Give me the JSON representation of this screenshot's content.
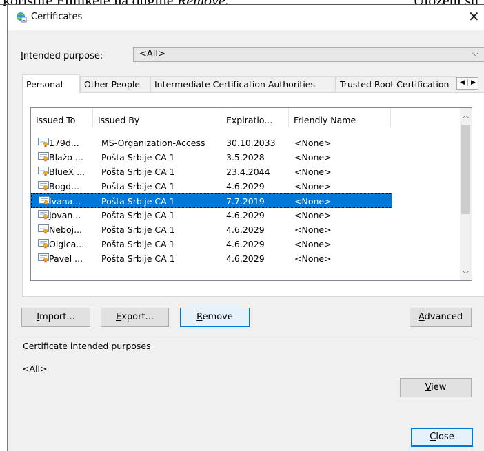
{
  "background": {
    "doc_text_left": "koristite Filmkete na dugme ",
    "doc_text_italic": "Remove.",
    "doc_text_right": "Uloženi su"
  },
  "window": {
    "title": "Certificates",
    "close_glyph": "✕"
  },
  "purpose": {
    "label_prefix": "I",
    "label_rest": "ntended purpose:",
    "value": "<All>"
  },
  "tabs": [
    {
      "label": "Personal",
      "active": true
    },
    {
      "label": "Other People",
      "active": false
    },
    {
      "label": "Intermediate Certification Authorities",
      "active": false
    },
    {
      "label": "Trusted Root Certification",
      "active": false
    }
  ],
  "list": {
    "columns": [
      "Issued To",
      "Issued By",
      "Expiratio...",
      "Friendly Name"
    ],
    "rows": [
      {
        "issued_to": "179d...",
        "issued_by": "MS-Organization-Access",
        "expiration": "30.10.2033",
        "friendly": "<None>",
        "selected": false
      },
      {
        "issued_to": "Blažo ...",
        "issued_by": "Pošta Srbije CA 1",
        "expiration": "3.5.2028",
        "friendly": "<None>",
        "selected": false
      },
      {
        "issued_to": "BlueX ...",
        "issued_by": "Pošta Srbije CA 1",
        "expiration": "23.4.2044",
        "friendly": "<None>",
        "selected": false
      },
      {
        "issued_to": "Bogd...",
        "issued_by": "Pošta Srbije CA 1",
        "expiration": "4.6.2029",
        "friendly": "<None>",
        "selected": false
      },
      {
        "issued_to": "Ivana...",
        "issued_by": "Pošta Srbije CA 1",
        "expiration": "7.7.2019",
        "friendly": "<None>",
        "selected": true
      },
      {
        "issued_to": "Jovan...",
        "issued_by": "Pošta Srbije CA 1",
        "expiration": "4.6.2029",
        "friendly": "<None>",
        "selected": false
      },
      {
        "issued_to": "Neboj...",
        "issued_by": "Pošta Srbije CA 1",
        "expiration": "4.6.2029",
        "friendly": "<None>",
        "selected": false
      },
      {
        "issued_to": "Olgica...",
        "issued_by": "Pošta Srbije CA 1",
        "expiration": "4.6.2029",
        "friendly": "<None>",
        "selected": false
      },
      {
        "issued_to": "Pavel ...",
        "issued_by": "Pošta Srbije CA 1",
        "expiration": "4.6.2029",
        "friendly": "<None>",
        "selected": false
      }
    ]
  },
  "buttons": {
    "import": {
      "u": "I",
      "rest": "mport..."
    },
    "export": {
      "u": "E",
      "rest": "xport..."
    },
    "remove": {
      "u": "R",
      "rest": "emove"
    },
    "advanced": {
      "u": "A",
      "rest": "dvanced"
    },
    "view": {
      "u": "V",
      "rest": "iew"
    },
    "close": {
      "u": "C",
      "rest": "lose"
    }
  },
  "purposes_group": {
    "label": "Certificate intended purposes",
    "value": "<All>"
  },
  "colors": {
    "selection": "#0078d7",
    "dialog_bg": "#f0f0f0"
  }
}
